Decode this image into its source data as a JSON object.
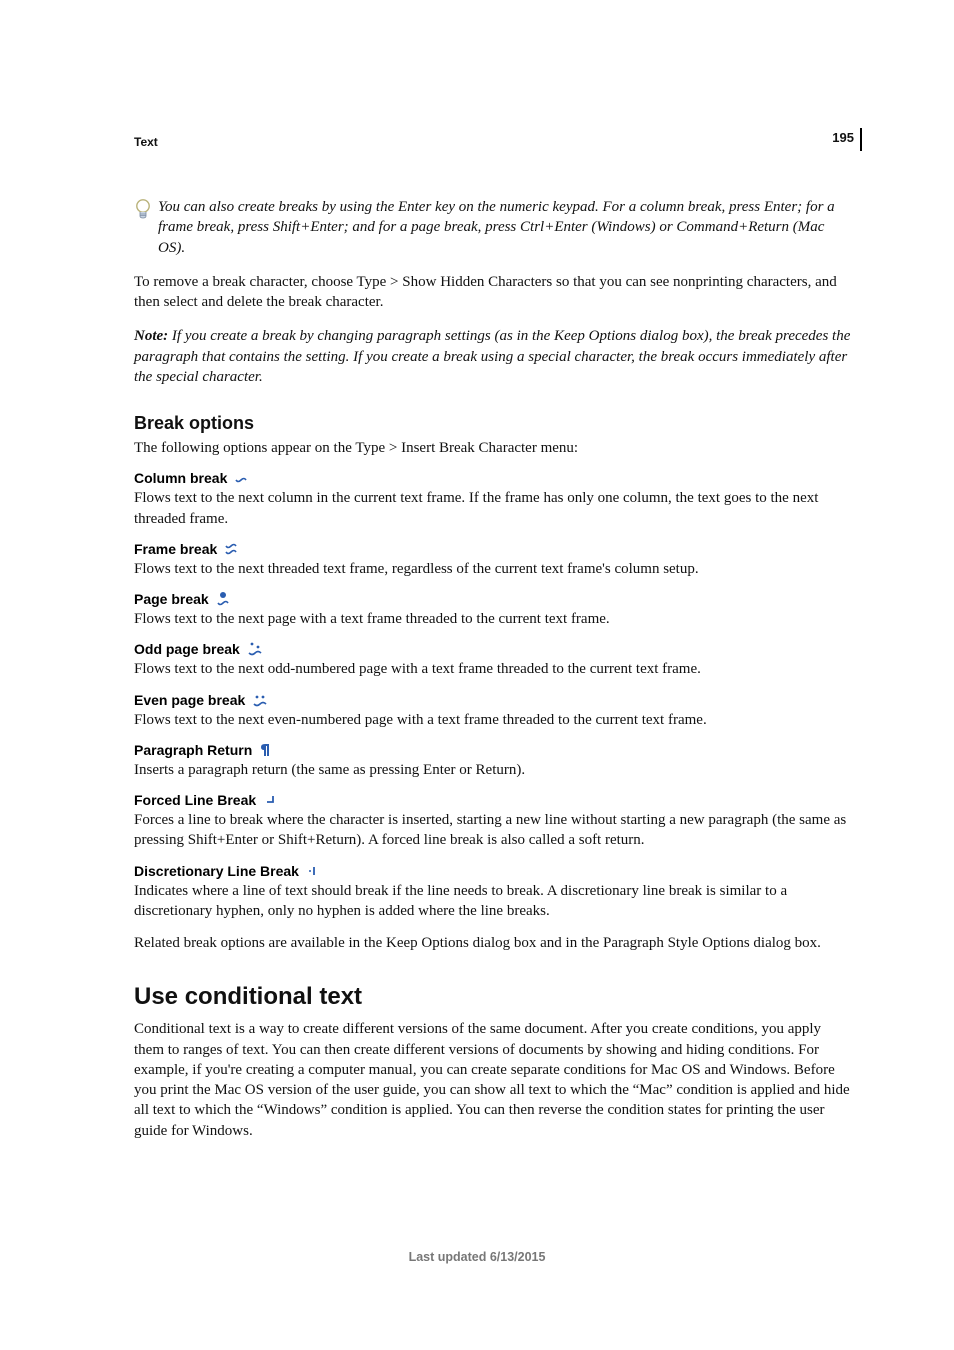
{
  "page_number": "195",
  "section_label": "Text",
  "tip": "You can also create breaks by using the Enter key on the numeric keypad. For a column break, press Enter; for a frame break, press Shift+Enter; and for a page break, press Ctrl+Enter (Windows) or Command+Return (Mac OS).",
  "remove_para": "To remove a break character, choose Type > Show Hidden Characters so that you can see nonprinting characters, and then select and delete the break character.",
  "note_label": "Note:",
  "note_body": " If you create a break by changing paragraph settings (as in the Keep Options dialog box), the break precedes the paragraph that contains the setting. If you create a break using a special character, the break occurs immediately after the special character.",
  "break_options_heading": "Break options",
  "break_options_intro": "The following options appear on the Type > Insert Break Character menu:",
  "defs": {
    "column": {
      "term": "Column break",
      "body": "Flows text to the next column in the current text frame. If the frame has only one column, the text goes to the next threaded frame."
    },
    "frame": {
      "term": "Frame break",
      "body": "Flows text to the next threaded text frame, regardless of the current text frame's column setup."
    },
    "page": {
      "term": "Page break",
      "body": "Flows text to the next page with a text frame threaded to the current text frame."
    },
    "odd": {
      "term": "Odd page break",
      "body": "Flows text to the next odd-numbered page with a text frame threaded to the current text frame."
    },
    "even": {
      "term": "Even page break",
      "body": "Flows text to the next even-numbered page with a text frame threaded to the current text frame."
    },
    "para": {
      "term": "Paragraph Return",
      "body": "Inserts a paragraph return (the same as pressing Enter or Return)."
    },
    "forced": {
      "term": "Forced Line Break",
      "body": "Forces a line to break where the character is inserted, starting a new line without starting a new paragraph (the same as pressing Shift+Enter or Shift+Return). A forced line break is also called a soft return."
    },
    "disc": {
      "term": "Discretionary Line Break",
      "body": "Indicates where a line of text should break if the line needs to break. A discretionary line break is similar to a discretionary hyphen, only no hyphen is added where the line breaks."
    }
  },
  "related_para": "Related break options are available in the Keep Options dialog box and in the Paragraph Style Options dialog box.",
  "conditional_heading": "Use conditional text",
  "conditional_body": "Conditional text is a way to create different versions of the same document. After you create conditions, you apply them to ranges of text. You can then create different versions of documents by showing and hiding conditions. For example, if you're creating a computer manual, you can create separate conditions for Mac OS and Windows. Before you print the Mac OS version of the user guide, you can show all text to which the “Mac” condition is applied and hide all text to which the “Windows” condition is applied. You can then reverse the condition states for printing the user guide for Windows.",
  "footer": "Last updated 6/13/2015"
}
